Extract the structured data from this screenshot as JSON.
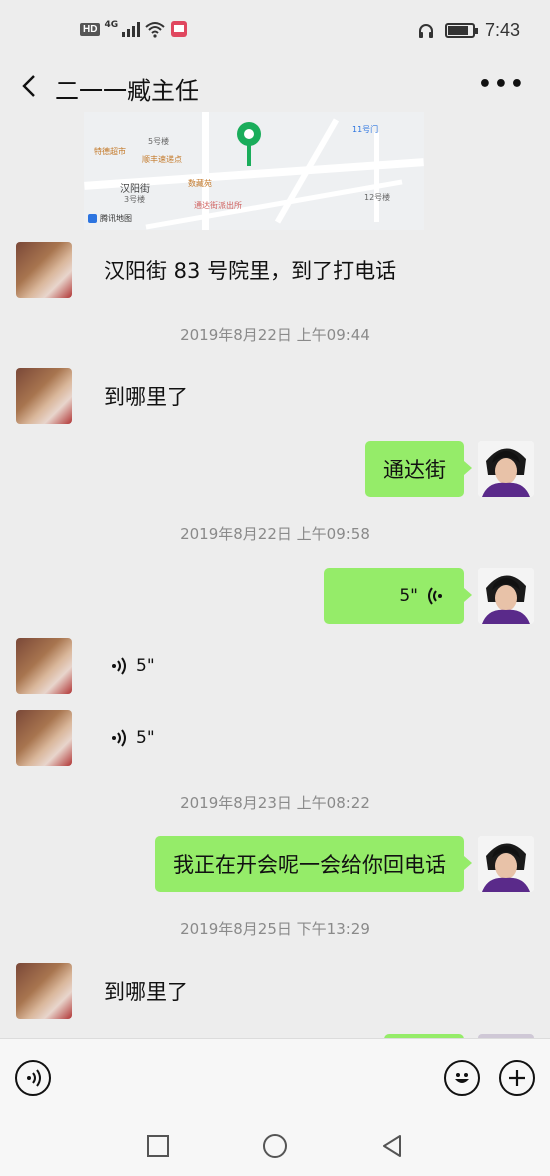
{
  "status": {
    "hd": "HD",
    "network": "4G",
    "time": "7:43",
    "battery_level": 0.85
  },
  "header": {
    "title": "二一一臧主任",
    "more_label": "•••"
  },
  "map": {
    "labels": [
      "汉阳街",
      "3号楼",
      "11号门",
      "12号楼",
      "5号楼"
    ],
    "pois": [
      "特德超市",
      "顺丰速递点",
      "数藏苑",
      "通达街派出所"
    ],
    "brand": "腾讯地图"
  },
  "messages": {
    "m1": "汉阳街 83 号院里，到了打电话",
    "ts1": "2019年8月22日 上午09:44",
    "m2": "到哪里了",
    "m3": "通达街",
    "ts2": "2019年8月22日 上午09:58",
    "m4_voice": "5\"",
    "m5_voice": "5\"",
    "m6_voice": "5\"",
    "ts3": "2019年8月23日 上午08:22",
    "m7": "我正在开会呢一会给你回电话",
    "ts4": "2019年8月25日 下午13:29",
    "m8": "到哪里了"
  },
  "icons": {
    "voice_input": "voice-icon",
    "emoji": "smiley-icon",
    "add": "plus-icon",
    "accent": "#95ec69",
    "pin_color": "#1aad5b"
  }
}
